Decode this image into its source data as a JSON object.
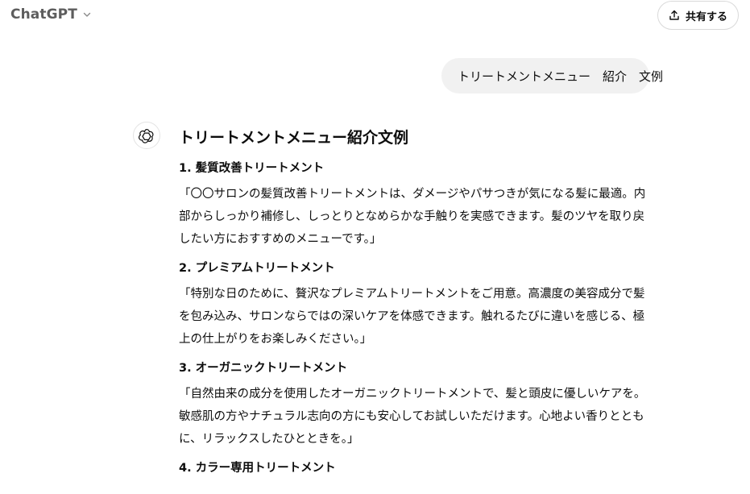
{
  "header": {
    "model_name": "ChatGPT",
    "share_label": "共有する"
  },
  "user_message": "トリートメントメニュー　紹介　文例",
  "assistant": {
    "title": "トリートメントメニュー紹介文例",
    "sections": [
      {
        "heading": "1. 髪質改善トリートメント",
        "body": "「〇〇サロンの髪質改善トリートメントは、ダメージやパサつきが気になる髪に最適。内部からしっかり補修し、しっとりとなめらかな手触りを実感できます。髪のツヤを取り戻したい方におすすめのメニューです。」"
      },
      {
        "heading": "2. プレミアムトリートメント",
        "body": "「特別な日のために、贅沢なプレミアムトリートメントをご用意。高濃度の美容成分で髪を包み込み、サロンならではの深いケアを体感できます。触れるたびに違いを感じる、極上の仕上がりをお楽しみください。」"
      },
      {
        "heading": "3. オーガニックトリートメント",
        "body": "「自然由来の成分を使用したオーガニックトリートメントで、髪と頭皮に優しいケアを。敏感肌の方やナチュラル志向の方にも安心してお試しいただけます。心地よい香りとともに、リラックスしたひとときを。」"
      },
      {
        "heading": "4. カラー専用トリートメント",
        "body": ""
      }
    ]
  },
  "icons": {
    "model_chevron": "chevron-down-icon",
    "share": "share-upload-icon",
    "assistant_avatar": "openai-logo-icon"
  }
}
